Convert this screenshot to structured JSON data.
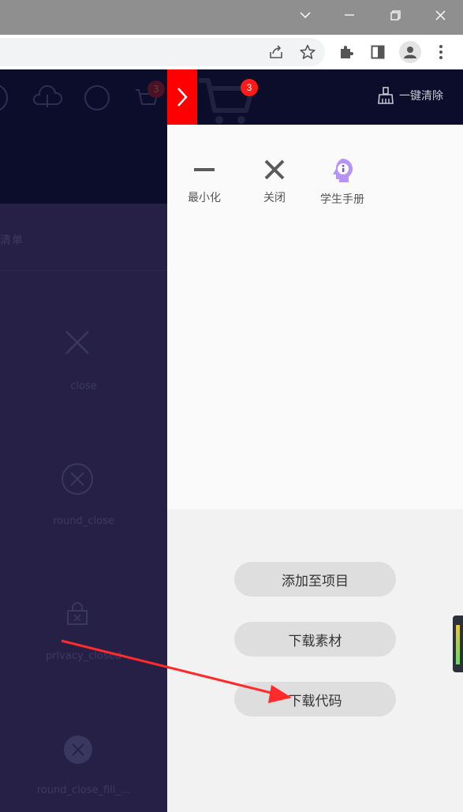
{
  "drawer": {
    "cart_count": "3",
    "clear_all": "一键清除",
    "tools": {
      "minimize": "最小化",
      "close": "关闭",
      "handbook": "学生手册"
    },
    "actions": {
      "add_to_project": "添加至项目",
      "download_material": "下载素材",
      "download_code": "下载代码"
    }
  },
  "background": {
    "cart_count": "3",
    "category_partial": "清单",
    "icons": [
      {
        "name": "close",
        "label": "close"
      },
      {
        "name": "round_close",
        "label": "round_close"
      },
      {
        "name": "privacy_closed",
        "label": "privacy_closed"
      },
      {
        "name": "round_close_fill",
        "label": "round_close_fill_..."
      }
    ]
  },
  "colors": {
    "drawer_toggle": "#ff0000",
    "header_dark": "#0b0d2a",
    "annotation_arrow": "#ff2a2a"
  }
}
